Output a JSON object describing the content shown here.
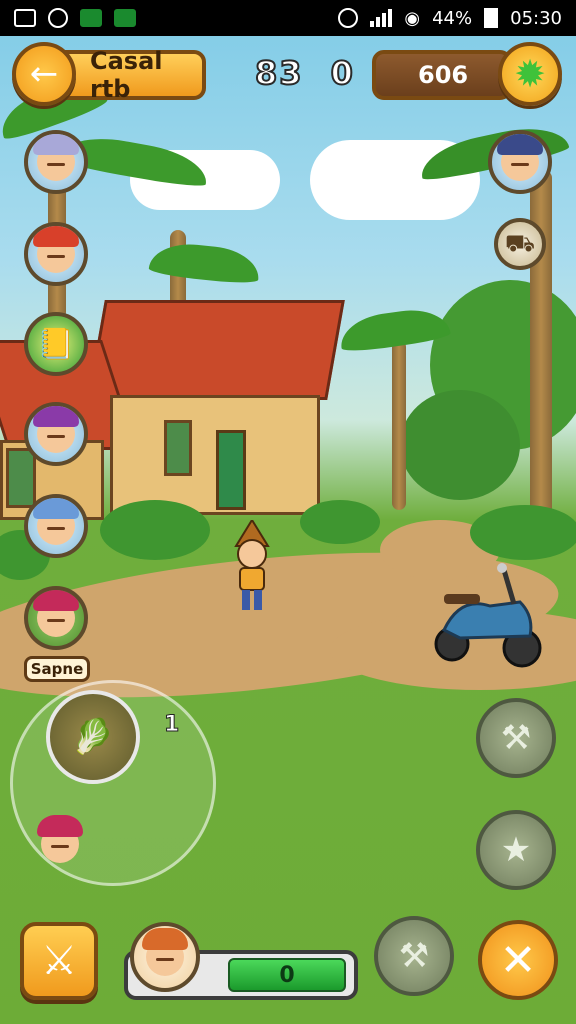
{
  "status_bar": {
    "battery_percent": "44%",
    "time": "05:30",
    "left_icons": [
      "gallery-icon",
      "alarm-icon",
      "app-icon-green",
      "app-icon-green-2"
    ],
    "right_icons": [
      "alarm-clock-icon",
      "signal-icon",
      "wifi-icon",
      "battery-icon"
    ]
  },
  "hud": {
    "back_icon": "arrow-left-icon",
    "title": "Casal rtb",
    "score_left": "83",
    "score_right": "0",
    "coins": "606",
    "gem_icon": "star-gem-icon"
  },
  "left_column": {
    "avatars": [
      "villager-avatar-1",
      "villager-avatar-2",
      "quest-book-icon",
      "villager-avatar-3",
      "villager-avatar-4",
      "villager-avatar-5"
    ],
    "tag_label": "Sapne"
  },
  "right_column": {
    "avatars": [
      "villager-avatar-top-right",
      "cart-icon"
    ]
  },
  "joystick": {
    "count_label": "1"
  },
  "controls": {
    "action_buttons": [
      "map-action-button",
      "star-action-button"
    ],
    "bottom_left_button": "sword-button",
    "bottom_mid_button": "build-button",
    "bottom_right_button": "close-button",
    "hp_label": "0",
    "hp_fill_fraction": 0.54
  },
  "colors": {
    "accent_orange": "#f29a1a",
    "hud_brown": "#7a4a12",
    "hp_green": "#1b9a2c",
    "grass": "#6dac37",
    "sky": "#7fcbe6"
  }
}
